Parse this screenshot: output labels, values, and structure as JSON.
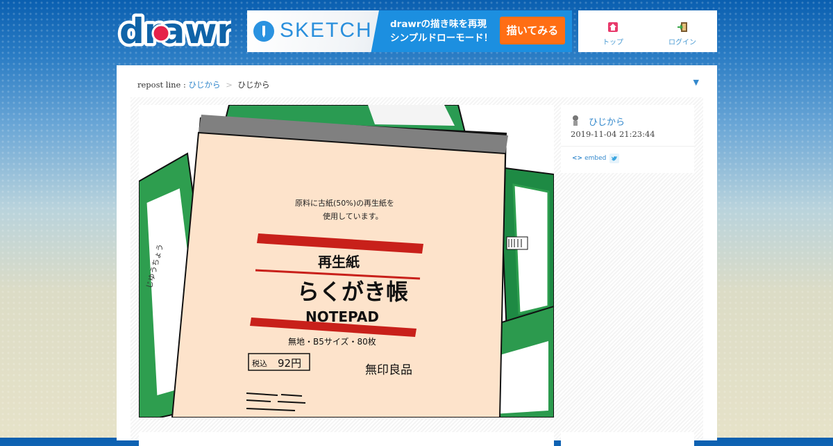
{
  "header": {
    "logo_text": "drawr",
    "banner": {
      "product": "SKETCH",
      "line1": "drawrの描き味を再現",
      "line2": "シンプルドローモード！",
      "cta": "描いてみる"
    },
    "nav": {
      "top_label": "トップ",
      "login_label": "ログイン"
    }
  },
  "repost": {
    "prefix": "repost line :",
    "link_user": "ひじから",
    "sep": ">",
    "current_user": "ひじから",
    "toggle_icon": "▼"
  },
  "post": {
    "user": "ひじから",
    "date": "2019-11-04 21:23:44",
    "embed_label": "embed"
  },
  "drawing": {
    "line1": "原料に古紙(50%)の再生紙を",
    "line2": "使用しています。",
    "kind": "再生紙",
    "title": "らくがき帳",
    "subtitle": "NOTEPAD",
    "spec": "無地・B5サイズ・80枚",
    "price_label": "税込",
    "price": "92円",
    "brand": "無印良品",
    "side_text": "じゆうちょう"
  },
  "colors": {
    "link": "#3388cc",
    "banner_blue": "#1c8fe0",
    "cta_orange": "#ff6e14"
  }
}
